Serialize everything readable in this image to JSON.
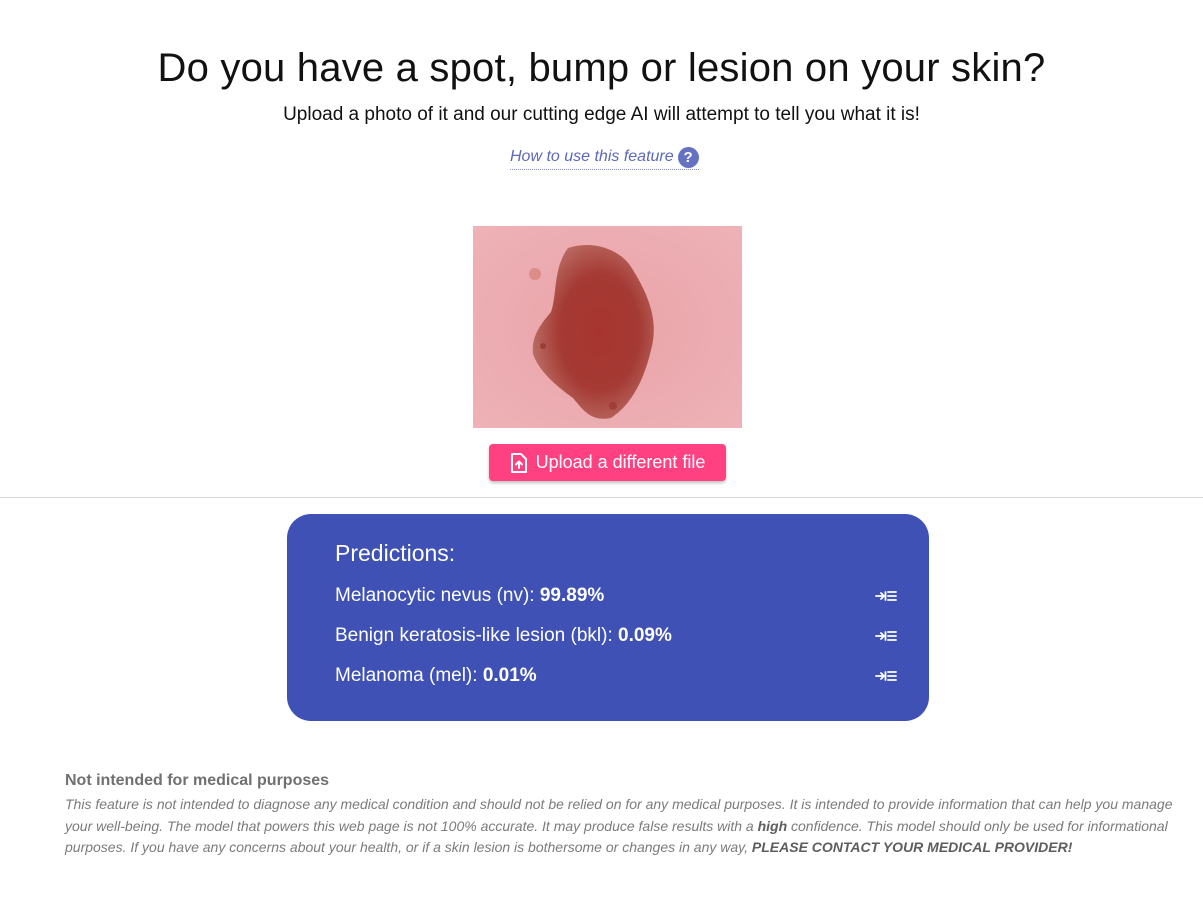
{
  "header": {
    "title": "Do you have a spot, bump or lesion on your skin?",
    "subtitle": "Upload a photo of it and our cutting edge AI will attempt to tell you what it is!",
    "howto_link": "How to use this feature",
    "howto_icon": "help-circle-icon"
  },
  "upload": {
    "button_label": "Upload a different file",
    "button_icon": "file-upload-icon",
    "button_color": "#ff4081"
  },
  "predictions": {
    "title": "Predictions:",
    "panel_color": "#3f51b5",
    "items": [
      {
        "label": "Melanocytic nevus (nv): ",
        "value": "99.89%",
        "icon": "expand-details-icon"
      },
      {
        "label": "Benign keratosis-like lesion (bkl): ",
        "value": "0.09%",
        "icon": "expand-details-icon"
      },
      {
        "label": "Melanoma (mel): ",
        "value": "0.01%",
        "icon": "expand-details-icon"
      }
    ]
  },
  "disclaimer": {
    "title": "Not intended for medical purposes",
    "body_part1": "This feature is not intended to diagnose any medical condition and should not be relied on for any medical purposes. It is intended to provide information that can help you manage your well-being. The model that powers this web page is not 100% accurate. It may produce false results with a ",
    "body_emphasis": "high",
    "body_part2": " confidence. This model should only be used for informational purposes. If you have any concerns about your health, or if a skin lesion is bothersome or changes in any way, ",
    "body_caps": "PLEASE CONTACT YOUR MEDICAL PROVIDER!"
  }
}
